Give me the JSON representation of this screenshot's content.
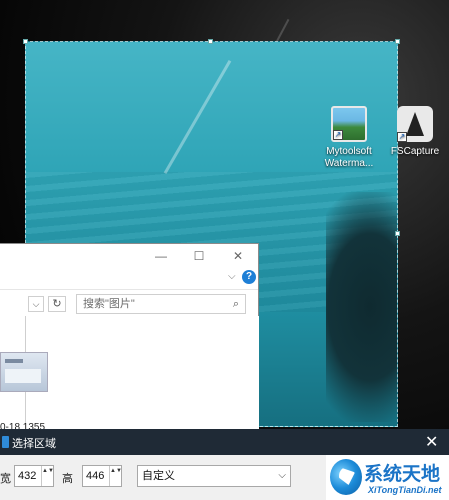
{
  "desktop": {
    "icons": [
      {
        "label_line1": "Mytoolsoft",
        "label_line2": "Waterma..."
      },
      {
        "label_line1": "FSCapture"
      }
    ]
  },
  "explorer": {
    "title_buttons": {
      "minimize": "—",
      "maximize": "☐",
      "close": "✕"
    },
    "ribbon_chevron": "⌵",
    "help": "?",
    "nav_dropdown": "⌵",
    "refresh": "↻",
    "search_placeholder": "搜索\"图片\"",
    "search_icon": "⌕",
    "file_label": "0-18 1355"
  },
  "dialog": {
    "title": "选择区域",
    "close": "✕",
    "width_label": "宽",
    "width_value": "432",
    "height_label": "高",
    "height_value": "446",
    "preset_value": "自定义",
    "spin_arrows": "▲▼",
    "select_caret": "⌵"
  },
  "logo": {
    "brand_cn": "系统天地",
    "brand_url": "XiTongTianDi.net"
  },
  "colors": {
    "water": "#2ea4b6",
    "dialog_title_bg": "#1f2a36",
    "dialog_body_bg": "#f0f0f0",
    "brand_blue": "#1b74c7",
    "help_blue": "#1e7fd6"
  }
}
